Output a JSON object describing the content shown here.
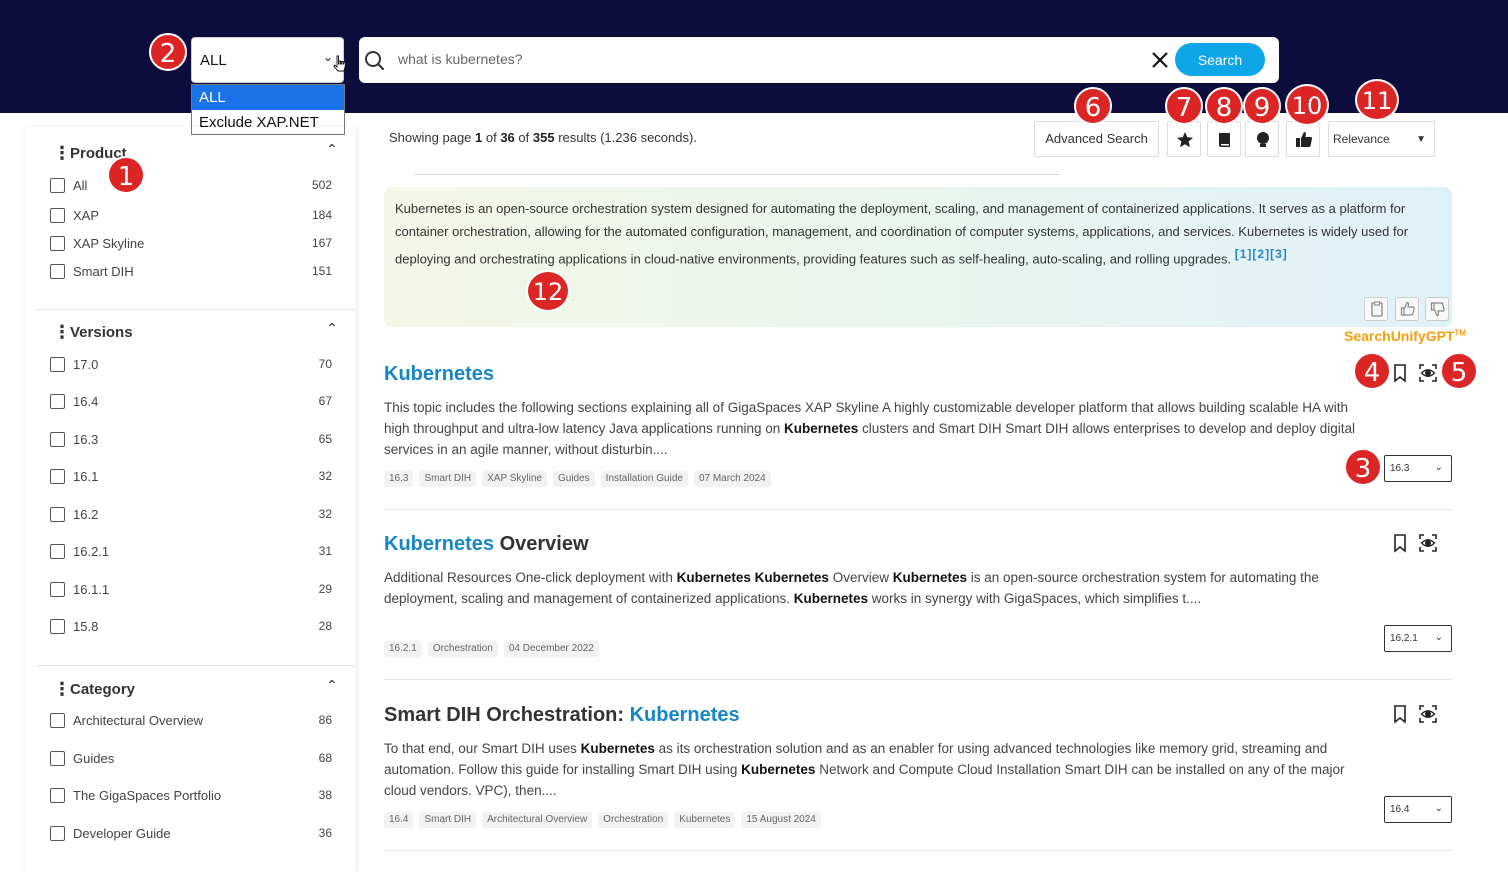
{
  "search": {
    "scope_selected": "ALL",
    "scope_options": [
      "ALL",
      "Exclude XAP.NET"
    ],
    "query": "what is kubernetes?",
    "button_label": "Search"
  },
  "badges": [
    "1",
    "2",
    "3",
    "4",
    "5",
    "6",
    "7",
    "8",
    "9",
    "10",
    "11",
    "12"
  ],
  "filters": {
    "product": {
      "title": "Product",
      "items": [
        {
          "label": "All",
          "count": "502"
        },
        {
          "label": "XAP",
          "count": "184"
        },
        {
          "label": "XAP Skyline",
          "count": "167"
        },
        {
          "label": "Smart DIH",
          "count": "151"
        }
      ]
    },
    "versions": {
      "title": "Versions",
      "items": [
        {
          "label": "17.0",
          "count": "70"
        },
        {
          "label": "16.4",
          "count": "67"
        },
        {
          "label": "16.3",
          "count": "65"
        },
        {
          "label": "16.1",
          "count": "32"
        },
        {
          "label": "16.2",
          "count": "32"
        },
        {
          "label": "16.2.1",
          "count": "31"
        },
        {
          "label": "16.1.1",
          "count": "29"
        },
        {
          "label": "15.8",
          "count": "28"
        }
      ]
    },
    "category": {
      "title": "Category",
      "items": [
        {
          "label": "Architectural Overview",
          "count": "86"
        },
        {
          "label": "Guides",
          "count": "68"
        },
        {
          "label": "The GigaSpaces Portfolio",
          "count": "38"
        },
        {
          "label": "Developer Guide",
          "count": "36"
        }
      ]
    }
  },
  "results_info": {
    "prefix": "Showing page ",
    "page": "1",
    "of1": " of ",
    "pages": "36",
    "of2": " of ",
    "total": "355",
    "suffix": " results (1.236 seconds)."
  },
  "toolbar": {
    "advanced_label": "Advanced Search",
    "sort_selected": "Relevance"
  },
  "gpt": {
    "answer": "Kubernetes is an open-source orchestration system designed for automating the deployment, scaling, and management of containerized applications. It serves as a platform for container orchestration, allowing for the automated configuration, management, and coordination of computer systems, applications, and services. Kubernetes is widely used for deploying and orchestrating applications in cloud-native environments, providing features such as self-healing, auto-scaling, and rolling upgrades.",
    "refs": "[1][2][3]",
    "brand": "SearchUnifyGPT",
    "tm": "TM"
  },
  "results": [
    {
      "title_hl": "Kubernetes",
      "title_rest": "",
      "desc_html": "This topic includes the following sections explaining all of GigaSpaces XAP Skyline A highly customizable developer platform that allows building scalable HA with high throughput and ultra-low latency Java applications running on <b>Kubernetes</b> clusters and Smart DIH Smart DIH allows enterprises to develop and deploy digital services in an agile manner, without disturbin....",
      "tags": [
        "16.3",
        "Smart DIH",
        "XAP Skyline",
        "Guides",
        "Installation Guide",
        "07 March 2024"
      ],
      "version": "16.3"
    },
    {
      "title_hl": "Kubernetes",
      "title_rest": " Overview",
      "desc_html": "Additional Resources One-click deployment with <b>Kubernetes Kubernetes</b> Overview <b>Kubernetes</b> is an open-source orchestration system for automating the deployment, scaling and management of containerized applications. <b>Kubernetes</b> works in synergy with GigaSpaces, which simplifies t....",
      "tags": [
        "16.2.1",
        "Orchestration",
        "04 December 2022"
      ],
      "version": "16.2.1"
    },
    {
      "title_pre": "Smart DIH Orchestration: ",
      "title_hl": "Kubernetes",
      "title_rest": "",
      "desc_html": "To that end, our Smart DIH uses <b>Kubernetes</b> as its orchestration solution and as an enabler for using advanced technologies like memory grid, streaming and automation. Follow this guide for installing Smart DIH using <b>Kubernetes</b> Network and Compute Cloud Installation Smart DIH can be installed on any of the major cloud vendors. VPC), then....",
      "tags": [
        "16.4",
        "Smart DIH",
        "Architectural Overview",
        "Orchestration",
        "Kubernetes",
        "15 August 2024"
      ],
      "version": "16.4"
    }
  ]
}
